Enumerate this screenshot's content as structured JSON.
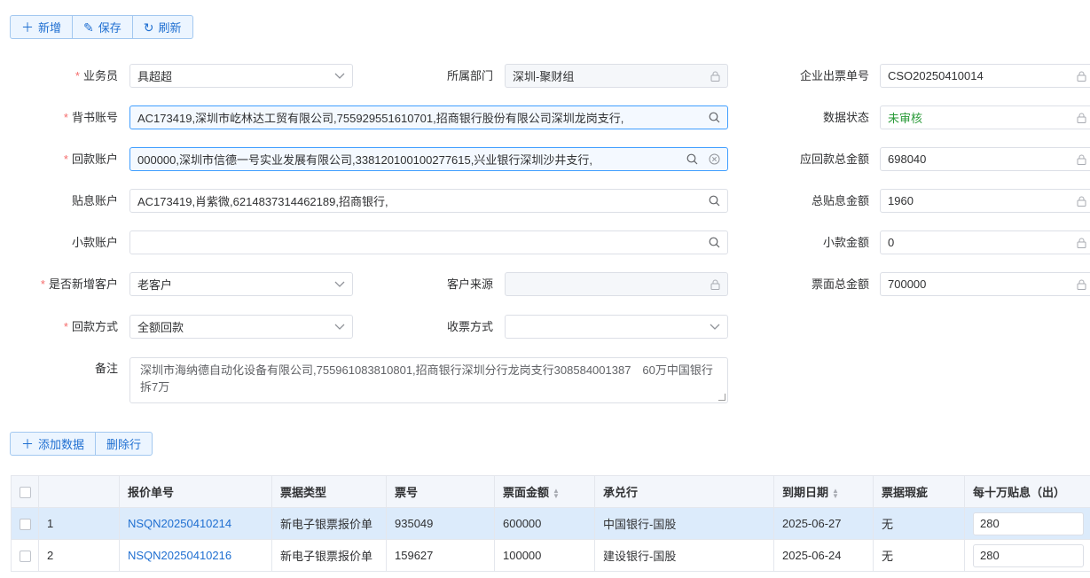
{
  "toolbar": {
    "add_label": "新增",
    "save_label": "保存",
    "refresh_label": "刷新"
  },
  "form": {
    "salesman_label": "业务员",
    "salesman_value": "具超超",
    "dept_label": "所属部门",
    "dept_value": "深圳-聚财组",
    "order_no_label": "企业出票单号",
    "order_no_value": "CSO20250410014",
    "endorse_label": "背书账号",
    "endorse_value": "AC173419,深圳市屹林达工贸有限公司,755929551610701,招商银行股份有限公司深圳龙岗支行,",
    "data_status_label": "数据状态",
    "data_status_value": "未审核",
    "return_acct_label": "回款账户",
    "return_acct_value": "000000,深圳市信德一号实业发展有限公司,338120100100277615,兴业银行深圳沙井支行,",
    "return_total_label": "应回款总金额",
    "return_total_value": "698040",
    "discount_acct_label": "贴息账户",
    "discount_acct_value": "AC173419,肖紫微,6214837314462189,招商银行,",
    "discount_total_label": "总贴息金额",
    "discount_total_value": "1960",
    "small_acct_label": "小款账户",
    "small_acct_value": "",
    "small_amount_label": "小款金额",
    "small_amount_value": "0",
    "new_cust_label": "是否新增客户",
    "new_cust_value": "老客户",
    "cust_source_label": "客户来源",
    "cust_source_value": "",
    "face_total_label": "票面总金额",
    "face_total_value": "700000",
    "return_mode_label": "回款方式",
    "return_mode_value": "全额回款",
    "receive_mode_label": "收票方式",
    "receive_mode_value": "",
    "remark_label": "备注",
    "remark_value": "深圳市海纳德自动化设备有限公司,755961083810801,招商银行深圳分行龙岗支行308584001387　60万中国银行拆7万"
  },
  "table_toolbar": {
    "add_row_label": "添加数据",
    "delete_row_label": "删除行"
  },
  "table": {
    "headers": [
      "报价单号",
      "票据类型",
      "票号",
      "票面金额",
      "承兑行",
      "到期日期",
      "票据瑕疵",
      "每十万贴息（出）"
    ],
    "rows": [
      {
        "index": "1",
        "quote_no": "NSQN20250410214",
        "type": "新电子银票报价单",
        "bill_no": "935049",
        "amount": "600000",
        "bank": "中国银行-国股",
        "due": "2025-06-27",
        "flaw": "无",
        "discount": "280"
      },
      {
        "index": "2",
        "quote_no": "NSQN20250410216",
        "type": "新电子银票报价单",
        "bill_no": "159627",
        "amount": "100000",
        "bank": "建设银行-国股",
        "due": "2025-06-24",
        "flaw": "无",
        "discount": "280"
      }
    ]
  },
  "colors": {
    "accent": "#1f6fd1",
    "required": "#f56c6c",
    "status_green": "#2b9b3a",
    "selected_row": "#dcebfb"
  }
}
